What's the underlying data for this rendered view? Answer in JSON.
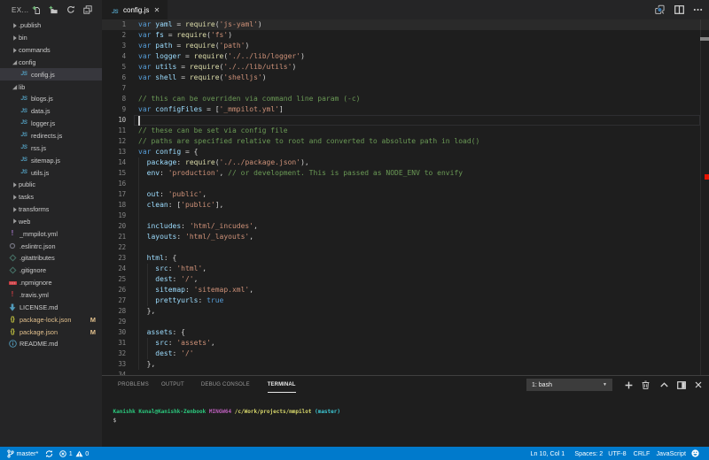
{
  "colors": {
    "statusbar": "#007acc",
    "sidebar_bg": "#252526",
    "editor_bg": "#1e1e1e",
    "selection_bg": "#37373d",
    "git_modified": "#e2c08d",
    "keyword": "#569cd6",
    "variable": "#9cdcfe",
    "function": "#dcdcaa",
    "string": "#ce9178",
    "comment": "#6a9955",
    "error_mark": "#e51400"
  },
  "sidebar": {
    "title": "EX...",
    "actions": [
      {
        "name": "new-file",
        "icon": "new-file-icon"
      },
      {
        "name": "new-folder",
        "icon": "new-folder-icon"
      },
      {
        "name": "refresh",
        "icon": "refresh-icon"
      },
      {
        "name": "collapse-all",
        "icon": "collapse-all-icon"
      }
    ],
    "tree": [
      {
        "kind": "folder",
        "label": ".publish",
        "state": "collapsed"
      },
      {
        "kind": "folder",
        "label": "bin",
        "state": "collapsed"
      },
      {
        "kind": "folder",
        "label": "commands",
        "state": "collapsed"
      },
      {
        "kind": "folder",
        "label": "config",
        "state": "expanded"
      },
      {
        "kind": "file",
        "label": "config.js",
        "level": 1,
        "icon": "js",
        "selected": true
      },
      {
        "kind": "folder",
        "label": "lib",
        "state": "expanded"
      },
      {
        "kind": "file",
        "label": "blogs.js",
        "level": 1,
        "icon": "js"
      },
      {
        "kind": "file",
        "label": "data.js",
        "level": 1,
        "icon": "js"
      },
      {
        "kind": "file",
        "label": "logger.js",
        "level": 1,
        "icon": "js"
      },
      {
        "kind": "file",
        "label": "redirects.js",
        "level": 1,
        "icon": "js"
      },
      {
        "kind": "file",
        "label": "rss.js",
        "level": 1,
        "icon": "js"
      },
      {
        "kind": "file",
        "label": "sitemap.js",
        "level": 1,
        "icon": "js"
      },
      {
        "kind": "file",
        "label": "utils.js",
        "level": 1,
        "icon": "js"
      },
      {
        "kind": "folder",
        "label": "public",
        "state": "collapsed"
      },
      {
        "kind": "folder",
        "label": "tasks",
        "state": "collapsed"
      },
      {
        "kind": "folder",
        "label": "transforms",
        "state": "collapsed"
      },
      {
        "kind": "folder",
        "label": "web",
        "state": "collapsed"
      },
      {
        "kind": "file",
        "label": "_mmpilot.yml",
        "level": 0,
        "icon": "yml"
      },
      {
        "kind": "file",
        "label": ".eslintrc.json",
        "level": 0,
        "icon": "eslint"
      },
      {
        "kind": "file",
        "label": ".gitattributes",
        "level": 0,
        "icon": "git"
      },
      {
        "kind": "file",
        "label": ".gitignore",
        "level": 0,
        "icon": "git"
      },
      {
        "kind": "file",
        "label": ".npmignore",
        "level": 0,
        "icon": "npm"
      },
      {
        "kind": "file",
        "label": ".travis.yml",
        "level": 0,
        "icon": "travis"
      },
      {
        "kind": "file",
        "label": "LICENSE.md",
        "level": 0,
        "icon": "license"
      },
      {
        "kind": "file",
        "label": "package-lock.json",
        "level": 0,
        "icon": "json",
        "badge": "M",
        "modified": true
      },
      {
        "kind": "file",
        "label": "package.json",
        "level": 0,
        "icon": "json",
        "badge": "M",
        "modified": true
      },
      {
        "kind": "file",
        "label": "README.md",
        "level": 0,
        "icon": "info"
      }
    ]
  },
  "editor": {
    "tab": {
      "label": "config.js",
      "icon": "js",
      "close_glyph": "✕"
    },
    "tab_actions": [
      {
        "name": "open-changes",
        "icon": "open-changes-icon"
      },
      {
        "name": "split-editor",
        "icon": "split-editor-icon"
      },
      {
        "name": "more-actions",
        "icon": "ellipsis-icon"
      }
    ],
    "cursor_line": 10,
    "code_lines": [
      {
        "n": 1,
        "segs": [
          [
            "var",
            "k"
          ],
          [
            " ",
            "p"
          ],
          [
            "yaml",
            "v"
          ],
          [
            " = ",
            "p"
          ],
          [
            "require",
            "f"
          ],
          [
            "(",
            "p"
          ],
          [
            "'js-yaml'",
            "s"
          ],
          [
            ")",
            "p"
          ]
        ]
      },
      {
        "n": 2,
        "segs": [
          [
            "var",
            "k"
          ],
          [
            " ",
            "p"
          ],
          [
            "fs",
            "v"
          ],
          [
            " = ",
            "p"
          ],
          [
            "require",
            "f"
          ],
          [
            "(",
            "p"
          ],
          [
            "'fs'",
            "s"
          ],
          [
            ")",
            "p"
          ]
        ]
      },
      {
        "n": 3,
        "segs": [
          [
            "var",
            "k"
          ],
          [
            " ",
            "p"
          ],
          [
            "path",
            "v"
          ],
          [
            " = ",
            "p"
          ],
          [
            "require",
            "f"
          ],
          [
            "(",
            "p"
          ],
          [
            "'path'",
            "s"
          ],
          [
            ")",
            "p"
          ]
        ]
      },
      {
        "n": 4,
        "segs": [
          [
            "var",
            "k"
          ],
          [
            " ",
            "p"
          ],
          [
            "logger",
            "v"
          ],
          [
            " = ",
            "p"
          ],
          [
            "require",
            "f"
          ],
          [
            "(",
            "p"
          ],
          [
            "'./../lib/logger'",
            "s"
          ],
          [
            ")",
            "p"
          ]
        ]
      },
      {
        "n": 5,
        "segs": [
          [
            "var",
            "k"
          ],
          [
            " ",
            "p"
          ],
          [
            "utils",
            "v"
          ],
          [
            " = ",
            "p"
          ],
          [
            "require",
            "f"
          ],
          [
            "(",
            "p"
          ],
          [
            "'./../lib/utils'",
            "s"
          ],
          [
            ")",
            "p"
          ]
        ]
      },
      {
        "n": 6,
        "segs": [
          [
            "var",
            "k"
          ],
          [
            " ",
            "p"
          ],
          [
            "shell",
            "v"
          ],
          [
            " = ",
            "p"
          ],
          [
            "require",
            "f"
          ],
          [
            "(",
            "p"
          ],
          [
            "'shelljs'",
            "s"
          ],
          [
            ")",
            "p"
          ]
        ]
      },
      {
        "n": 7,
        "segs": []
      },
      {
        "n": 8,
        "segs": [
          [
            "// this can be overriden via command line param (-c)",
            "c"
          ]
        ]
      },
      {
        "n": 9,
        "segs": [
          [
            "var",
            "k"
          ],
          [
            " ",
            "p"
          ],
          [
            "configFiles",
            "v"
          ],
          [
            " = [",
            "p"
          ],
          [
            "'_mmpilot.yml'",
            "s"
          ],
          [
            "]",
            "p"
          ]
        ]
      },
      {
        "n": 10,
        "segs": []
      },
      {
        "n": 11,
        "segs": [
          [
            "// these can be set via config file",
            "c"
          ]
        ]
      },
      {
        "n": 12,
        "segs": [
          [
            "// paths are specified relative to root and converted to absolute path in load()",
            "c"
          ]
        ]
      },
      {
        "n": 13,
        "segs": [
          [
            "var",
            "k"
          ],
          [
            " ",
            "p"
          ],
          [
            "config",
            "v"
          ],
          [
            " = {",
            "p"
          ]
        ]
      },
      {
        "n": 14,
        "segs": [
          [
            "  ",
            "p"
          ],
          [
            "package",
            "v"
          ],
          [
            ": ",
            "p"
          ],
          [
            "require",
            "f"
          ],
          [
            "(",
            "p"
          ],
          [
            "'./../package.json'",
            "s"
          ],
          [
            "),",
            "p"
          ]
        ]
      },
      {
        "n": 15,
        "segs": [
          [
            "  ",
            "p"
          ],
          [
            "env",
            "v"
          ],
          [
            ": ",
            "p"
          ],
          [
            "'production'",
            "s"
          ],
          [
            ", ",
            "p"
          ],
          [
            "// or development. This is passed as NODE_ENV to envify",
            "c"
          ]
        ]
      },
      {
        "n": 16,
        "segs": []
      },
      {
        "n": 17,
        "segs": [
          [
            "  ",
            "p"
          ],
          [
            "out",
            "v"
          ],
          [
            ": ",
            "p"
          ],
          [
            "'public'",
            "s"
          ],
          [
            ",",
            "p"
          ]
        ]
      },
      {
        "n": 18,
        "segs": [
          [
            "  ",
            "p"
          ],
          [
            "clean",
            "v"
          ],
          [
            ": [",
            "p"
          ],
          [
            "'public'",
            "s"
          ],
          [
            "],",
            "p"
          ]
        ]
      },
      {
        "n": 19,
        "segs": []
      },
      {
        "n": 20,
        "segs": [
          [
            "  ",
            "p"
          ],
          [
            "includes",
            "v"
          ],
          [
            ": ",
            "p"
          ],
          [
            "'html/_incudes'",
            "s"
          ],
          [
            ",",
            "p"
          ]
        ]
      },
      {
        "n": 21,
        "segs": [
          [
            "  ",
            "p"
          ],
          [
            "layouts",
            "v"
          ],
          [
            ": ",
            "p"
          ],
          [
            "'html/_layouts'",
            "s"
          ],
          [
            ",",
            "p"
          ]
        ]
      },
      {
        "n": 22,
        "segs": []
      },
      {
        "n": 23,
        "segs": [
          [
            "  ",
            "p"
          ],
          [
            "html",
            "v"
          ],
          [
            ": {",
            "p"
          ]
        ]
      },
      {
        "n": 24,
        "segs": [
          [
            "    ",
            "p"
          ],
          [
            "src",
            "v"
          ],
          [
            ": ",
            "p"
          ],
          [
            "'html'",
            "s"
          ],
          [
            ",",
            "p"
          ]
        ]
      },
      {
        "n": 25,
        "segs": [
          [
            "    ",
            "p"
          ],
          [
            "dest",
            "v"
          ],
          [
            ": ",
            "p"
          ],
          [
            "'/'",
            "s"
          ],
          [
            ",",
            "p"
          ]
        ]
      },
      {
        "n": 26,
        "segs": [
          [
            "    ",
            "p"
          ],
          [
            "sitemap",
            "v"
          ],
          [
            ": ",
            "p"
          ],
          [
            "'sitemap.xml'",
            "s"
          ],
          [
            ",",
            "p"
          ]
        ]
      },
      {
        "n": 27,
        "segs": [
          [
            "    ",
            "p"
          ],
          [
            "prettyurls",
            "v"
          ],
          [
            ": ",
            "p"
          ],
          [
            "true",
            "k"
          ]
        ]
      },
      {
        "n": 28,
        "segs": [
          [
            "  },",
            "p"
          ]
        ]
      },
      {
        "n": 29,
        "segs": []
      },
      {
        "n": 30,
        "segs": [
          [
            "  ",
            "p"
          ],
          [
            "assets",
            "v"
          ],
          [
            ": {",
            "p"
          ]
        ]
      },
      {
        "n": 31,
        "segs": [
          [
            "    ",
            "p"
          ],
          [
            "src",
            "v"
          ],
          [
            ": ",
            "p"
          ],
          [
            "'assets'",
            "s"
          ],
          [
            ",",
            "p"
          ]
        ]
      },
      {
        "n": 32,
        "segs": [
          [
            "    ",
            "p"
          ],
          [
            "dest",
            "v"
          ],
          [
            ": ",
            "p"
          ],
          [
            "'/'",
            "s"
          ]
        ]
      },
      {
        "n": 33,
        "segs": [
          [
            "  },",
            "p"
          ]
        ]
      },
      {
        "n": 34,
        "segs": []
      }
    ]
  },
  "panel": {
    "tabs": [
      {
        "label": "PROBLEMS",
        "active": false
      },
      {
        "label": "OUTPUT",
        "active": false
      },
      {
        "label": "DEBUG CONSOLE",
        "active": false
      },
      {
        "label": "TERMINAL",
        "active": true
      }
    ],
    "terminal_select": "1: bash",
    "actions": [
      {
        "name": "new-terminal",
        "icon": "plus-icon"
      },
      {
        "name": "kill-terminal",
        "icon": "trash-icon"
      },
      {
        "name": "maximize-panel",
        "icon": "chevron-up-icon"
      },
      {
        "name": "split-terminal",
        "icon": "split-panel-icon"
      },
      {
        "name": "close-panel",
        "icon": "close-icon"
      }
    ],
    "terminal_lines": [
      [
        [
          "Kanishk Kunal@Kanishk-Zenbook ",
          "t-green"
        ],
        [
          "MINGW64 ",
          "t-mag"
        ],
        [
          "/c/Work/projects/mmpilot ",
          "t-yel"
        ],
        [
          "(master)",
          "t-cyan"
        ]
      ],
      [
        [
          "$",
          "t-fg"
        ]
      ]
    ]
  },
  "statusbar": {
    "left": [
      {
        "name": "git-branch",
        "icon": "branch-icon",
        "label": "master*"
      },
      {
        "name": "sync",
        "icon": "sync-icon",
        "label": ""
      },
      {
        "name": "errors",
        "icon": "error-icon",
        "label": "1"
      },
      {
        "name": "warnings",
        "icon": "warning-icon",
        "label": "0"
      }
    ],
    "right": [
      {
        "name": "cursor-position",
        "label": "Ln 10, Col 1"
      },
      {
        "name": "indentation",
        "label": "Spaces: 2"
      },
      {
        "name": "encoding",
        "label": "UTF-8"
      },
      {
        "name": "eol",
        "label": "CRLF"
      },
      {
        "name": "language-mode",
        "label": "JavaScript"
      },
      {
        "name": "feedback",
        "icon": "smiley-icon",
        "label": ""
      }
    ]
  }
}
